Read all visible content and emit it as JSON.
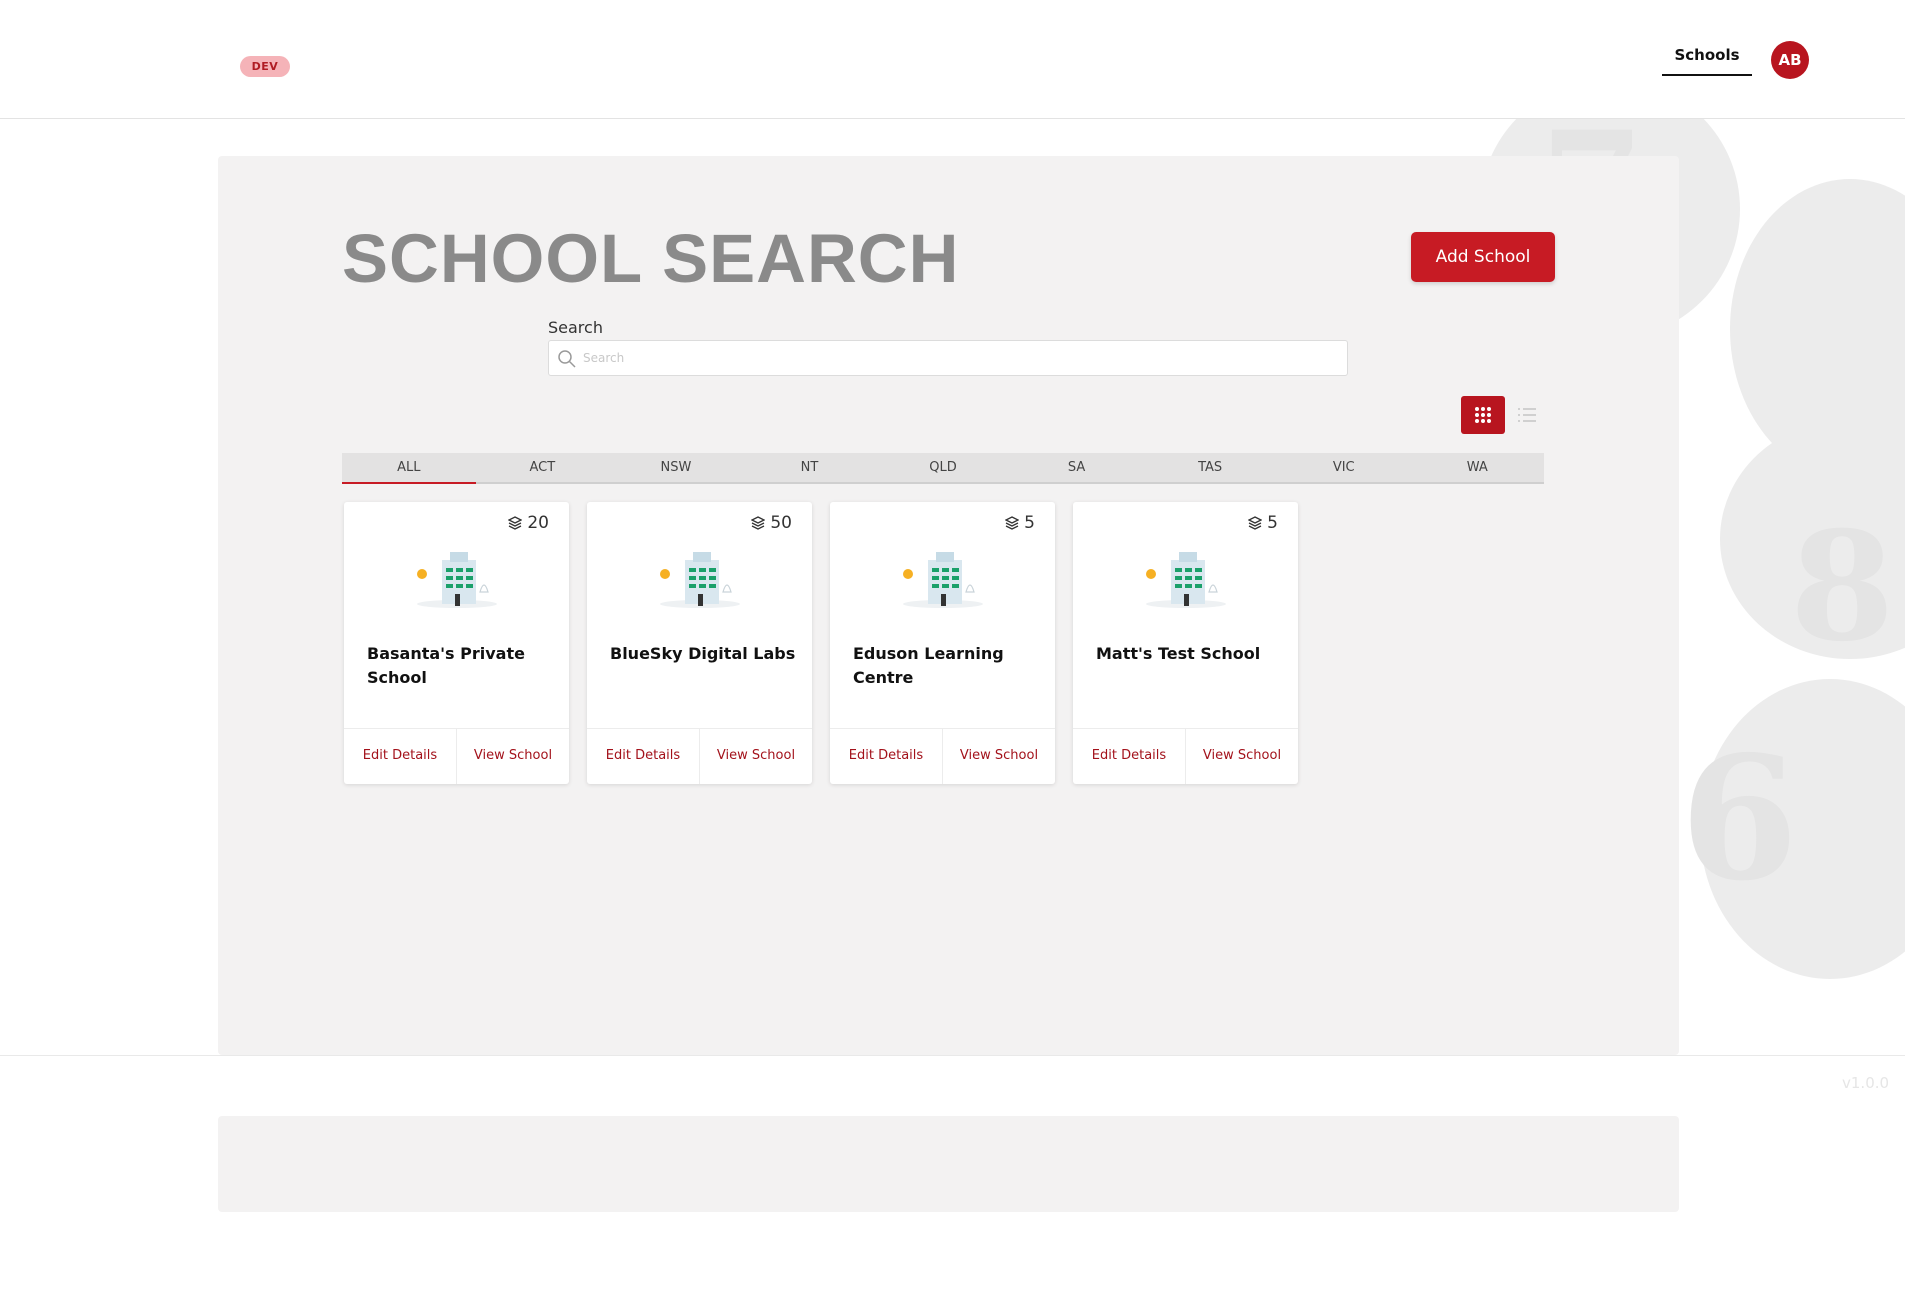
{
  "header": {
    "env_badge": "DEV",
    "nav_schools": "Schools",
    "avatar_initials": "AB"
  },
  "page": {
    "title": "SCHOOL SEARCH",
    "add_button": "Add School",
    "search_label": "Search",
    "search_placeholder": "Search"
  },
  "view_toggle": {
    "grid_icon": "grid-icon",
    "list_icon": "list-icon",
    "active": "grid"
  },
  "tabs": [
    "ALL",
    "ACT",
    "NSW",
    "NT",
    "QLD",
    "SA",
    "TAS",
    "VIC",
    "WA"
  ],
  "active_tab": "ALL",
  "cards": [
    {
      "count": "20",
      "name": "Basanta's Private School",
      "edit": "Edit Details",
      "view": "View School"
    },
    {
      "count": "50",
      "name": "BlueSky Digital Labs",
      "edit": "Edit Details",
      "view": "View School"
    },
    {
      "count": "5",
      "name": "Eduson Learning Centre",
      "edit": "Edit Details",
      "view": "View School"
    },
    {
      "count": "5",
      "name": "Matt's Test School",
      "edit": "Edit Details",
      "view": "View School"
    }
  ],
  "footer": {
    "version": "v1.0.0"
  },
  "colors": {
    "brand": "#c71b24",
    "panel": "#f3f2f2",
    "title": "#8a8a8a"
  }
}
